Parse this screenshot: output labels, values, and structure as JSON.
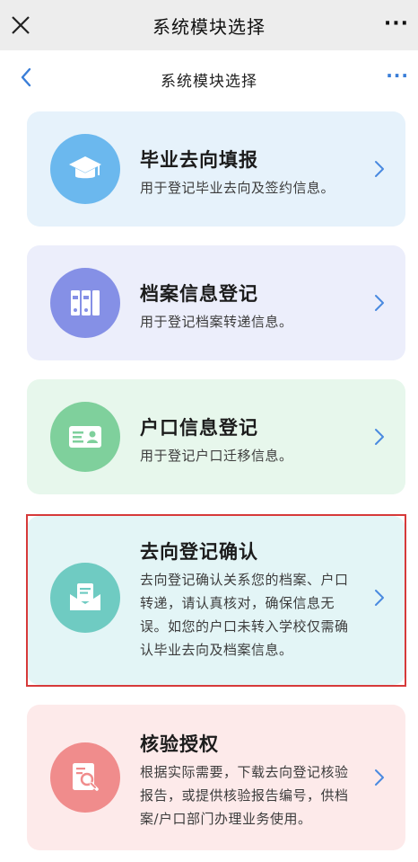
{
  "topbar": {
    "title": "系统模块选择",
    "more": "···"
  },
  "navbar": {
    "title": "系统模块选择",
    "more": "···"
  },
  "cards": [
    {
      "title": "毕业去向填报",
      "desc": "用于登记毕业去向及签约信息。",
      "icon": "graduation-cap-icon",
      "color": "#6bb8ee",
      "bg": "#e6f2fb"
    },
    {
      "title": "档案信息登记",
      "desc": "用于登记档案转递信息。",
      "icon": "file-folder-icon",
      "color": "#8590e6",
      "bg": "#eceefb"
    },
    {
      "title": "户口信息登记",
      "desc": "用于登记户口迁移信息。",
      "icon": "id-card-icon",
      "color": "#7fd09c",
      "bg": "#e7f7ec"
    },
    {
      "title": "去向登记确认",
      "desc_lines": [
        "去向登记确认关系您的档案、户口",
        "转递，请认真核对，确保信息无",
        "误。如您的户口未转入学校仅需确",
        "认毕业去向及档案信息。"
      ],
      "icon": "envelope-letter-icon",
      "color": "#6fcbc2",
      "bg": "#e3f5f6"
    },
    {
      "title": "核验授权",
      "desc_lines": [
        "根据实际需要，下载去向登记核验",
        "报告，或提供核验报告编号，供档",
        "案/户口部门办理业务使用。"
      ],
      "icon": "search-document-icon",
      "color": "#f08c8c",
      "bg": "#fdeaea"
    }
  ]
}
